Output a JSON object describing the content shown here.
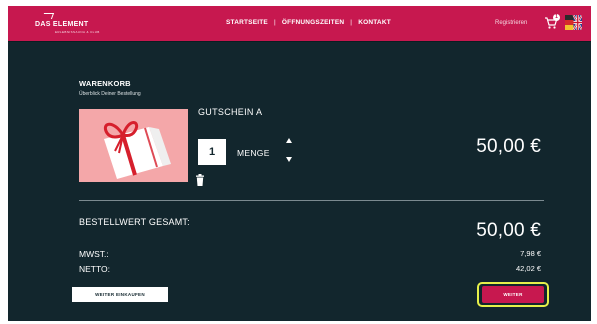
{
  "header": {
    "logo_text": "DAS ELEMENT",
    "logo_sub": "ERLEBNISSAUNA & CLUB",
    "nav": [
      "STARTSEITE",
      "ÖFFNUNGSZEITEN",
      "KONTAKT"
    ],
    "nav_separator": "|",
    "register": "Registrieren",
    "cart_count": "1",
    "brand_color": "#c7184f"
  },
  "cart": {
    "title": "WARENKORB",
    "subtitle": "Überblick Deiner Bestellung",
    "item": {
      "name": "GUTSCHEIN A",
      "quantity": "1",
      "quantity_label": "MENGE",
      "price": "50,00 €"
    },
    "total_label": "BESTELLWERT GESAMT:",
    "total_value": "50,00 €",
    "mwst_label": "MWST.:",
    "mwst_value": "7,98 €",
    "netto_label": "NETTO:",
    "netto_value": "42,02 €",
    "continue_shopping_label": "WEITER EINKAUFEN",
    "next_label": "WEITER"
  },
  "colors": {
    "background": "#12262d",
    "header": "#c7184f",
    "product_bg": "#f4a7a9",
    "highlight": "#e6f04a"
  }
}
